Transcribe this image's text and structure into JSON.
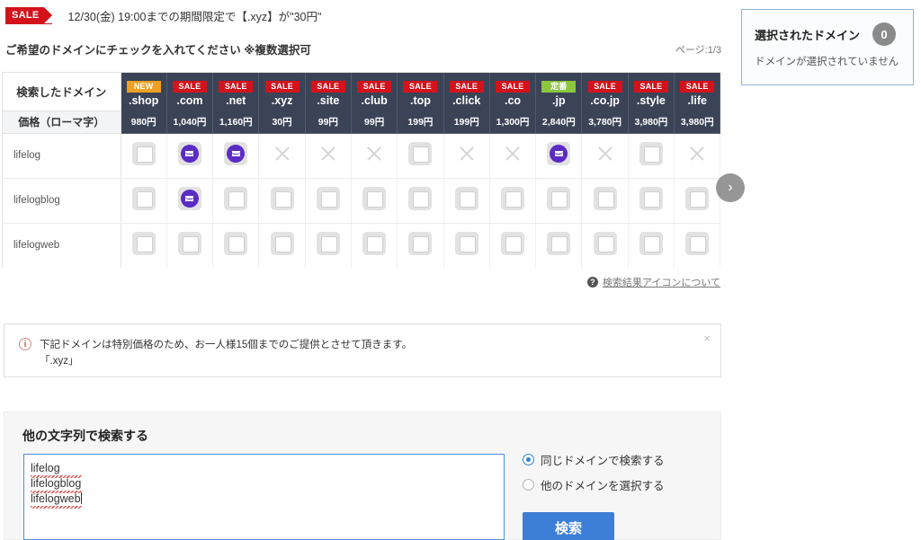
{
  "banner": {
    "flag_label": "SALE",
    "text": "12/30(金) 19:00までの期間限定で【.xyz】が\"30円\""
  },
  "instruction": "ご希望のドメインにチェックを入れてください ※複数選択可",
  "page_indicator": "ページ:1/3",
  "selected_panel": {
    "title": "選択されたドメイン",
    "count": "0",
    "empty_message": "ドメインが選択されていません"
  },
  "table": {
    "header_label": "検索したドメイン",
    "price_label": "価格（ローマ字）",
    "columns": [
      {
        "badge": "NEW",
        "badge_type": "new",
        "tld": ".shop",
        "price": "980円"
      },
      {
        "badge": "SALE",
        "badge_type": "sale",
        "tld": ".com",
        "price": "1,040円"
      },
      {
        "badge": "SALE",
        "badge_type": "sale",
        "tld": ".net",
        "price": "1,160円"
      },
      {
        "badge": "SALE",
        "badge_type": "sale",
        "tld": ".xyz",
        "price": "30円"
      },
      {
        "badge": "SALE",
        "badge_type": "sale",
        "tld": ".site",
        "price": "99円"
      },
      {
        "badge": "SALE",
        "badge_type": "sale",
        "tld": ".club",
        "price": "99円"
      },
      {
        "badge": "SALE",
        "badge_type": "sale",
        "tld": ".top",
        "price": "199円"
      },
      {
        "badge": "SALE",
        "badge_type": "sale",
        "tld": ".click",
        "price": "199円"
      },
      {
        "badge": "SALE",
        "badge_type": "sale",
        "tld": ".co",
        "price": "1,300円"
      },
      {
        "badge": "定番",
        "badge_type": "teiban",
        "tld": ".jp",
        "price": "2,840円"
      },
      {
        "badge": "SALE",
        "badge_type": "sale",
        "tld": ".co.jp",
        "price": "3,780円"
      },
      {
        "badge": "SALE",
        "badge_type": "sale",
        "tld": ".style",
        "price": "3,980円"
      },
      {
        "badge": "SALE",
        "badge_type": "sale",
        "tld": ".life",
        "price": "3,980円"
      }
    ],
    "rows": [
      {
        "label": "lifelog",
        "cells": [
          "checkbox",
          "mail",
          "mail",
          "unavailable",
          "unavailable",
          "unavailable",
          "checkbox",
          "unavailable",
          "unavailable",
          "mail",
          "unavailable",
          "checkbox",
          "unavailable"
        ]
      },
      {
        "label": "lifelogblog",
        "cells": [
          "checkbox",
          "mail",
          "checkbox",
          "checkbox",
          "checkbox",
          "checkbox",
          "checkbox",
          "checkbox",
          "checkbox",
          "checkbox",
          "checkbox",
          "checkbox",
          "checkbox"
        ]
      },
      {
        "label": "lifelogweb",
        "cells": [
          "checkbox",
          "checkbox",
          "checkbox",
          "checkbox",
          "checkbox",
          "checkbox",
          "checkbox",
          "checkbox",
          "checkbox",
          "checkbox",
          "checkbox",
          "checkbox",
          "checkbox"
        ]
      }
    ],
    "next_arrow_glyph": "›"
  },
  "legend": {
    "icon_glyph": "?",
    "link_text": "検索結果アイコンについて"
  },
  "notice": {
    "icon_glyph": "i",
    "line1": "下記ドメインは特別価格のため、お一人様15個までのご提供とさせて頂きます。",
    "line2": "「.xyz」",
    "close_glyph": "×"
  },
  "search_panel": {
    "title": "他の文字列で検索する",
    "textarea_value": "lifelog\nlifelogblog\nlifelogweb",
    "textarea_lines": [
      "lifelog",
      "lifelogblog",
      "lifelogweb"
    ],
    "radio_same": "同じドメインで検索する",
    "radio_other": "他のドメインを選択する",
    "selected_radio": "same",
    "button_label": "検索"
  },
  "colors": {
    "sale_red": "#d4121b",
    "new_orange": "#eda022",
    "teiban_green": "#8cc63e",
    "header_slate": "#3b4457",
    "mail_purple": "#5b2bc4",
    "button_blue": "#3d7fd6",
    "panel_border_blue": "#8fb3d9"
  }
}
